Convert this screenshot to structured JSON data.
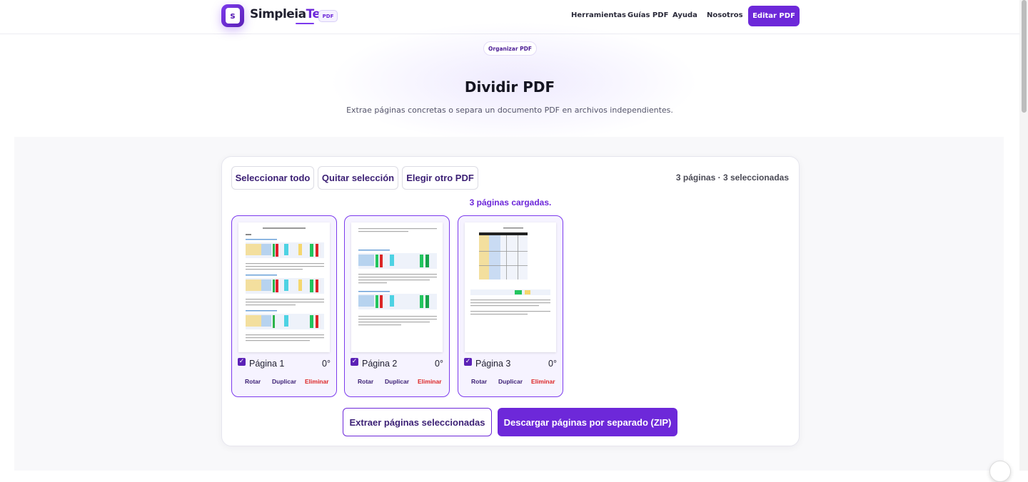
{
  "header": {
    "logo_letter": "s",
    "brand_main": "Simpleia",
    "brand_accent": "Tec",
    "brand_tag": "PDF",
    "nav": [
      "Herramientas",
      "Guías PDF",
      "Ayuda",
      "Nosotros"
    ],
    "cta": "Editar PDF"
  },
  "hero": {
    "pill": "Organizar PDF",
    "title": "Dividir PDF",
    "subtitle": "Extrae páginas concretas o separa un documento PDF en archivos independientes."
  },
  "toolbar": {
    "select_all": "Seleccionar todo",
    "clear_selection": "Quitar selección",
    "choose_other": "Elegir otro PDF",
    "count": "3 páginas · 3 seleccionadas",
    "loaded": "3 páginas cargadas."
  },
  "pages": [
    {
      "label": "Página 1",
      "rotation": "0°",
      "checked": true
    },
    {
      "label": "Página 2",
      "rotation": "0°",
      "checked": true
    },
    {
      "label": "Página 3",
      "rotation": "0°",
      "checked": true
    }
  ],
  "page_actions": {
    "rotate": "Rotar",
    "duplicate": "Duplicar",
    "delete": "Eliminar"
  },
  "actions": {
    "extract": "Extraer páginas seleccionadas",
    "zip": "Descargar páginas por separado (ZIP)"
  },
  "colors": {
    "accent": "#6d28d9",
    "danger": "#dc2626"
  }
}
